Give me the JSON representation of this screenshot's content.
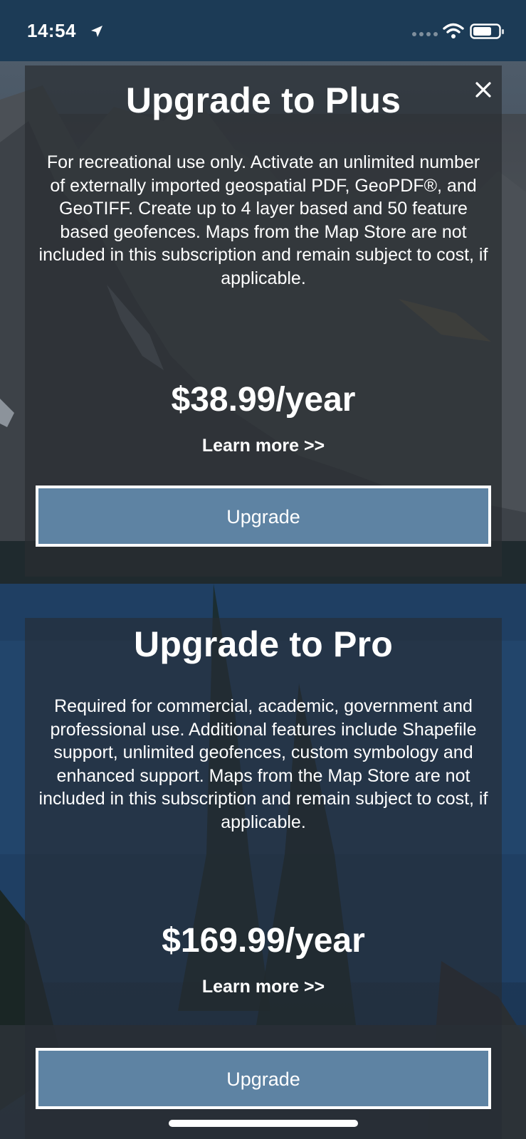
{
  "status_bar": {
    "time": "14:54",
    "icons": [
      "location-arrow-icon",
      "cellular-signal-icon",
      "wifi-icon",
      "battery-icon"
    ]
  },
  "colors": {
    "status_bar_bg": "#1c3b56",
    "card_bg": "rgba(42,45,50,0.70)",
    "button_bg": "#5e83a3",
    "button_border": "#ffffff",
    "text": "#ffffff"
  },
  "plans": [
    {
      "title": "Upgrade to Plus",
      "description": "For recreational use only. Activate an unlimited number of externally imported geospatial PDF, GeoPDF®, and GeoTIFF. Create up to 4 layer based and 50 feature based geofences. Maps from the Map Store are not included in this subscription and remain subject to cost, if applicable.",
      "price": "$38.99/year",
      "learn_more": "Learn more >>",
      "button": "Upgrade"
    },
    {
      "title": "Upgrade to Pro",
      "description": "Required for commercial, academic, government and professional use. Additional features include Shapefile support, unlimited geofences, custom symbology and enhanced support. Maps from the Map Store are not included in this subscription and remain subject to cost, if applicable.",
      "price": "$169.99/year",
      "learn_more": "Learn more >>",
      "button": "Upgrade"
    }
  ],
  "close_icon": "close-icon"
}
